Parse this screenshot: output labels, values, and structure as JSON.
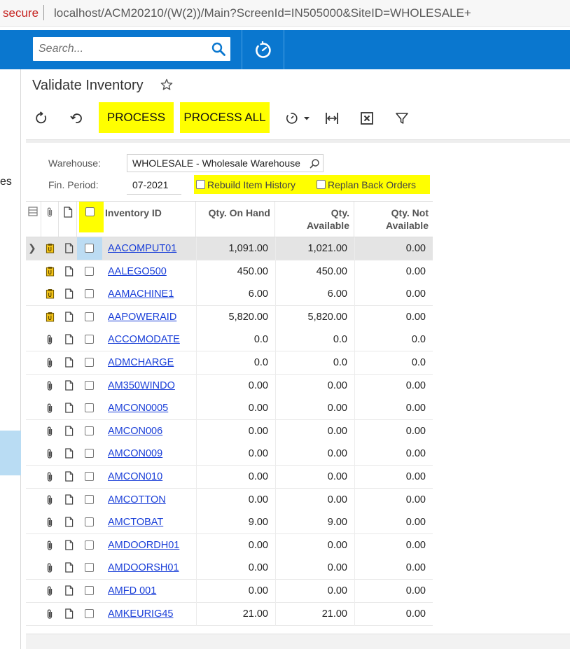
{
  "browser": {
    "security_label": "secure",
    "url": "localhost/ACM20210/(W(2))/Main?ScreenId=IN505000&SiteID=WHOLESALE+"
  },
  "topbar": {
    "search_placeholder": "Search...",
    "color": "#0a77cf"
  },
  "leftnav": {
    "fragment_text": "es"
  },
  "page": {
    "title": "Validate Inventory"
  },
  "toolbar": {
    "process_label": "PROCESS",
    "process_all_label": "PROCESS ALL",
    "icons": [
      "refresh-icon",
      "undo-icon",
      "schedule-icon",
      "fit-columns-icon",
      "export-excel-icon",
      "filter-icon"
    ],
    "highlight_color": "#ffff00"
  },
  "form": {
    "warehouse_label": "Warehouse:",
    "warehouse_value": "WHOLESALE - Wholesale Warehouse",
    "period_label": "Fin. Period:",
    "period_value": "07-2021",
    "rebuild_label": "Rebuild Item History",
    "replan_label": "Replan Back Orders"
  },
  "grid": {
    "columns": {
      "inventory_id": "Inventory ID",
      "qty_on_hand": "Qty. On Hand",
      "qty_available_1": "Qty.",
      "qty_available_2": "Available",
      "qty_not_available_1": "Qty. Not",
      "qty_not_available_2": "Available"
    },
    "rows": [
      {
        "id": "AACOMPUT01",
        "on_hand": "1,091.00",
        "available": "1,021.00",
        "not_available": "0.00",
        "attach": "note-yellow"
      },
      {
        "id": "AALEGO500",
        "on_hand": "450.00",
        "available": "450.00",
        "not_available": "0.00",
        "attach": "note-yellow"
      },
      {
        "id": "AAMACHINE1",
        "on_hand": "6.00",
        "available": "6.00",
        "not_available": "0.00",
        "attach": "note-yellow"
      },
      {
        "id": "AAPOWERAID",
        "on_hand": "5,820.00",
        "available": "5,820.00",
        "not_available": "0.00",
        "attach": "note-yellow"
      },
      {
        "id": "ACCOMODATE",
        "on_hand": "0.0",
        "available": "0.0",
        "not_available": "0.0",
        "attach": "paperclip"
      },
      {
        "id": "ADMCHARGE",
        "on_hand": "0.0",
        "available": "0.0",
        "not_available": "0.0",
        "attach": "paperclip"
      },
      {
        "id": "AM350WINDO",
        "on_hand": "0.00",
        "available": "0.00",
        "not_available": "0.00",
        "attach": "paperclip"
      },
      {
        "id": "AMCON0005",
        "on_hand": "0.00",
        "available": "0.00",
        "not_available": "0.00",
        "attach": "paperclip"
      },
      {
        "id": "AMCON006",
        "on_hand": "0.00",
        "available": "0.00",
        "not_available": "0.00",
        "attach": "paperclip"
      },
      {
        "id": "AMCON009",
        "on_hand": "0.00",
        "available": "0.00",
        "not_available": "0.00",
        "attach": "paperclip"
      },
      {
        "id": "AMCON010",
        "on_hand": "0.00",
        "available": "0.00",
        "not_available": "0.00",
        "attach": "paperclip"
      },
      {
        "id": "AMCOTTON",
        "on_hand": "0.00",
        "available": "0.00",
        "not_available": "0.00",
        "attach": "paperclip"
      },
      {
        "id": "AMCTOBAT",
        "on_hand": "9.00",
        "available": "9.00",
        "not_available": "0.00",
        "attach": "paperclip"
      },
      {
        "id": "AMDOORDH01",
        "on_hand": "0.00",
        "available": "0.00",
        "not_available": "0.00",
        "attach": "paperclip"
      },
      {
        "id": "AMDOORSH01",
        "on_hand": "0.00",
        "available": "0.00",
        "not_available": "0.00",
        "attach": "paperclip"
      },
      {
        "id": "AMFD 001",
        "on_hand": "0.00",
        "available": "0.00",
        "not_available": "0.00",
        "attach": "paperclip"
      },
      {
        "id": "AMKEURIG45",
        "on_hand": "21.00",
        "available": "21.00",
        "not_available": "0.00",
        "attach": "paperclip"
      }
    ]
  }
}
